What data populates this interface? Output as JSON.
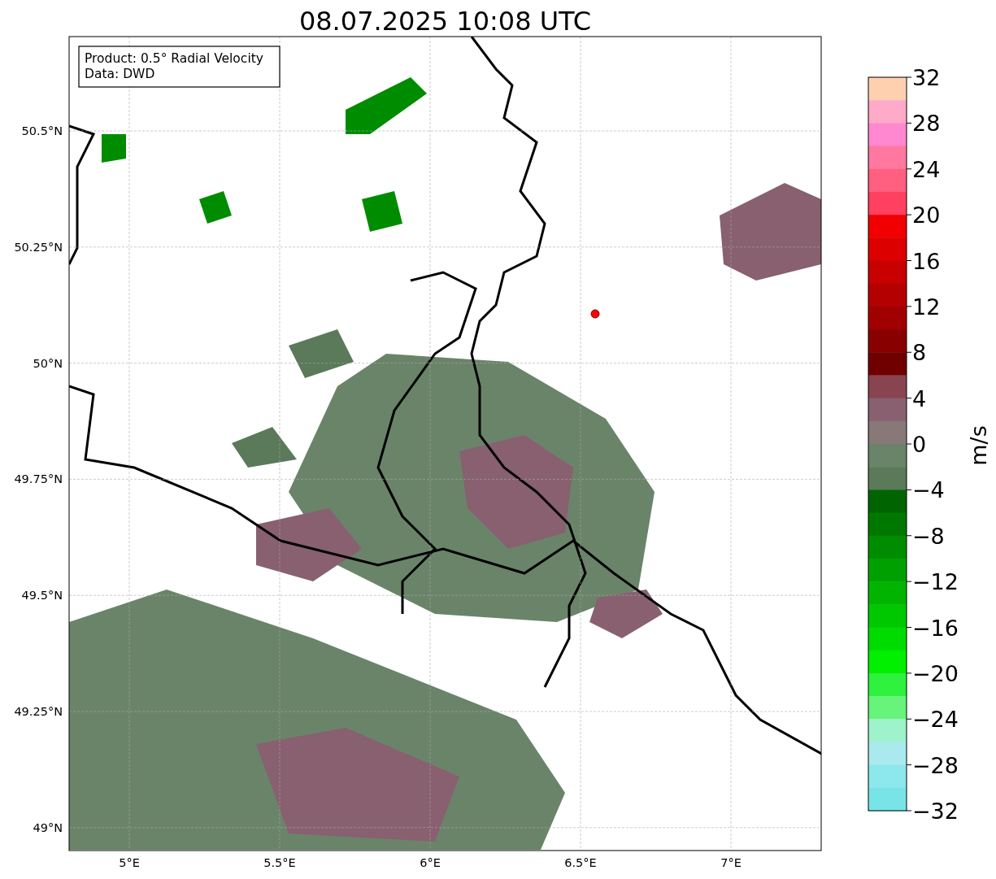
{
  "title": "08.07.2025 10:08 UTC",
  "legend": [
    "Product: 0.5° Radial Velocity",
    "Data: DWD"
  ],
  "map": {
    "lat_ticks": [
      "50.5°N",
      "50.25°N",
      "50°N",
      "49.75°N",
      "49.5°N",
      "49.25°N",
      "49°N"
    ],
    "lon_ticks": [
      "5°E",
      "5.5°E",
      "6°E",
      "6.5°E",
      "7°E"
    ]
  },
  "colorbar": {
    "label": "m/s",
    "ticks": [
      "32",
      "28",
      "24",
      "20",
      "16",
      "12",
      "8",
      "4",
      "0",
      "−4",
      "−8",
      "−12",
      "−16",
      "−20",
      "−24",
      "−28",
      "−32"
    ],
    "bins": [
      {
        "color": "#ffd0b0"
      },
      {
        "color": "#ffaac8"
      },
      {
        "color": "#ff88d0"
      },
      {
        "color": "#ff78a0"
      },
      {
        "color": "#ff6080"
      },
      {
        "color": "#ff4060"
      },
      {
        "color": "#f00000"
      },
      {
        "color": "#dc0000"
      },
      {
        "color": "#c80000"
      },
      {
        "color": "#b40000"
      },
      {
        "color": "#a00000"
      },
      {
        "color": "#880000"
      },
      {
        "color": "#700000"
      },
      {
        "color": "#884450"
      },
      {
        "color": "#886070"
      },
      {
        "color": "#887878"
      },
      {
        "color": "#6a846a"
      },
      {
        "color": "#5a7a5a"
      },
      {
        "color": "#006400"
      },
      {
        "color": "#007800"
      },
      {
        "color": "#008c00"
      },
      {
        "color": "#00a000"
      },
      {
        "color": "#00b400"
      },
      {
        "color": "#00c800"
      },
      {
        "color": "#00dc00"
      },
      {
        "color": "#00f000"
      },
      {
        "color": "#2ef23e"
      },
      {
        "color": "#66f47a"
      },
      {
        "color": "#9ef2cc"
      },
      {
        "color": "#aaeaee"
      },
      {
        "color": "#8ce8ec"
      },
      {
        "color": "#78e4e8"
      }
    ]
  }
}
